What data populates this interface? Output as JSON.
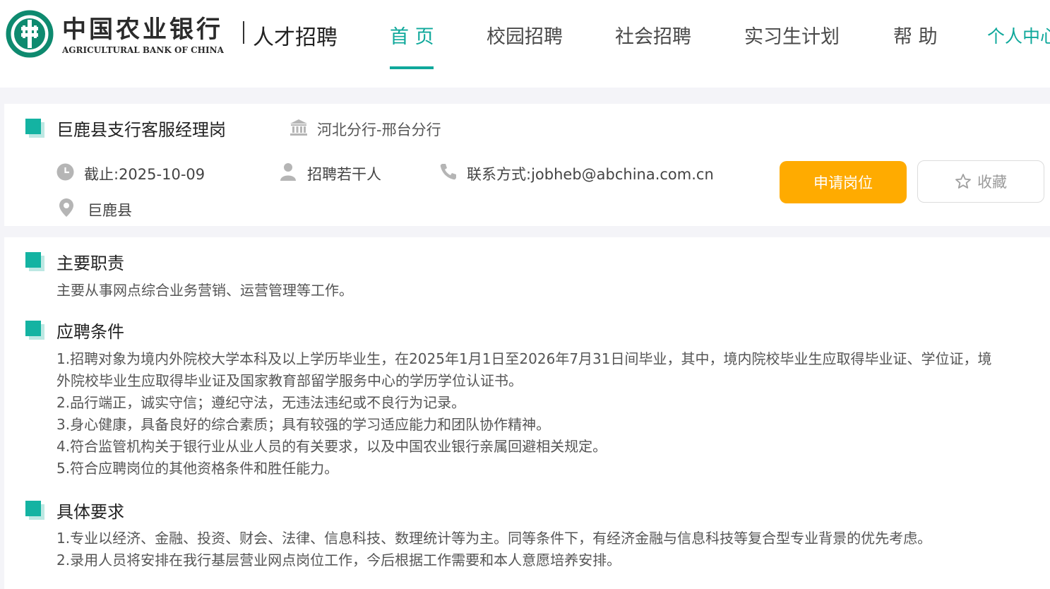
{
  "header": {
    "bank_name_cn": "中国农业银行",
    "bank_name_en": "AGRICULTURAL BANK OF CHINA",
    "site_name": "人才招聘",
    "logo_icon": "abc-bank-logo-icon",
    "brand_color": "#0fa89b",
    "nav": [
      {
        "label": "首 页",
        "active": true
      },
      {
        "label": "校园招聘"
      },
      {
        "label": "社会招聘"
      },
      {
        "label": "实习生计划"
      },
      {
        "label": "帮 助"
      },
      {
        "label": "个人中心"
      }
    ]
  },
  "job": {
    "title": "巨鹿县支行客服经理岗",
    "branch": "河北分行-邢台分行",
    "deadline": "截止:2025-10-09",
    "headcount": "招聘若干人",
    "contact": "联系方式:jobheb@abchina.com.cn",
    "location": "巨鹿县",
    "apply_label": "申请岗位",
    "favorite_label": "收藏",
    "apply_color": "#ffab00"
  },
  "sections": {
    "duties": {
      "title": "主要职责",
      "lines": [
        "主要从事网点综合业务营销、运营管理等工作。"
      ]
    },
    "requirements": {
      "title": "应聘条件",
      "lines": [
        "1.招聘对象为境内外院校大学本科及以上学历毕业生，在2025年1月1日至2026年7月31日间毕业，其中，境内院校毕业生应取得毕业证、学位证，境",
        "外院校毕业生应取得毕业证及国家教育部留学服务中心的学历学位认证书。",
        "2.品行端正，诚实守信；遵纪守法，无违法违纪或不良行为记录。",
        "3.身心健康，具备良好的综合素质；具有较强的学习适应能力和团队协作精神。",
        "4.符合监管机构关于银行业从业人员的有关要求，以及中国农业银行亲属回避相关规定。",
        "5.符合应聘岗位的其他资格条件和胜任能力。"
      ]
    },
    "specific": {
      "title": "具体要求",
      "lines": [
        "1.专业以经济、金融、投资、财会、法律、信息科技、数理统计等为主。同等条件下，有经济金融与信息科技等复合型专业背景的优先考虑。",
        "2.录用人员将安排在我行基层营业网点岗位工作，今后根据工作需要和本人意愿培养安排。"
      ]
    }
  }
}
